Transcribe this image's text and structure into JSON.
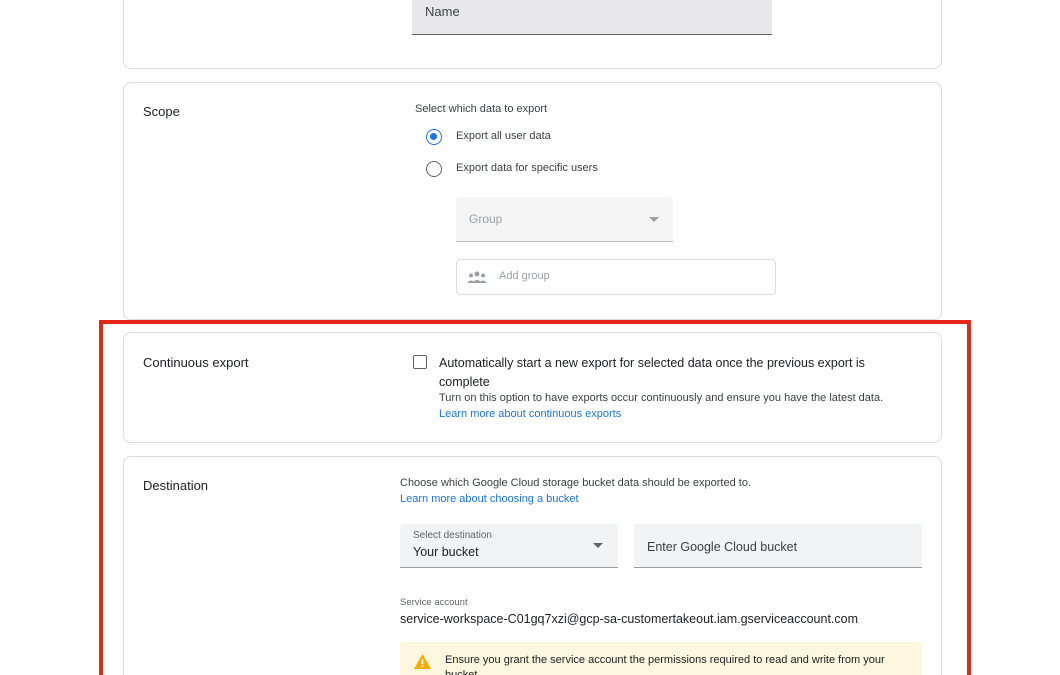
{
  "name_section": {
    "field_label": "Name"
  },
  "scope": {
    "title": "Scope",
    "prompt": "Select which data to export",
    "options": [
      {
        "label": "Export all user data",
        "selected": true
      },
      {
        "label": "Export data for specific users",
        "selected": false
      }
    ],
    "group_select_placeholder": "Group",
    "add_group_placeholder": "Add group"
  },
  "continuous": {
    "title": "Continuous export",
    "checkbox_label": "Automatically start a new export for selected data once the previous export is complete",
    "checked": false,
    "help_text": "Turn on this option to have exports occur continuously and ensure you have the latest data.",
    "link_text": "Learn more about continuous exports"
  },
  "destination": {
    "title": "Destination",
    "prompt": "Choose which Google Cloud storage bucket data should be exported to.",
    "link_text": "Learn more about choosing a bucket",
    "select_label": "Select destination",
    "select_value": "Your bucket",
    "bucket_placeholder": "Enter Google Cloud bucket",
    "service_account_label": "Service account",
    "service_account_value": "service-workspace-C01gq7xzi@gcp-sa-customertakeout.iam.gserviceaccount.com",
    "warning_text": "Ensure you grant the service account the permissions required to read and write from your bucket"
  },
  "colors": {
    "accent": "#1a73e8",
    "highlight": "#e52517",
    "warning_bg": "#fef7e0",
    "warning_icon": "#f9ab00"
  }
}
